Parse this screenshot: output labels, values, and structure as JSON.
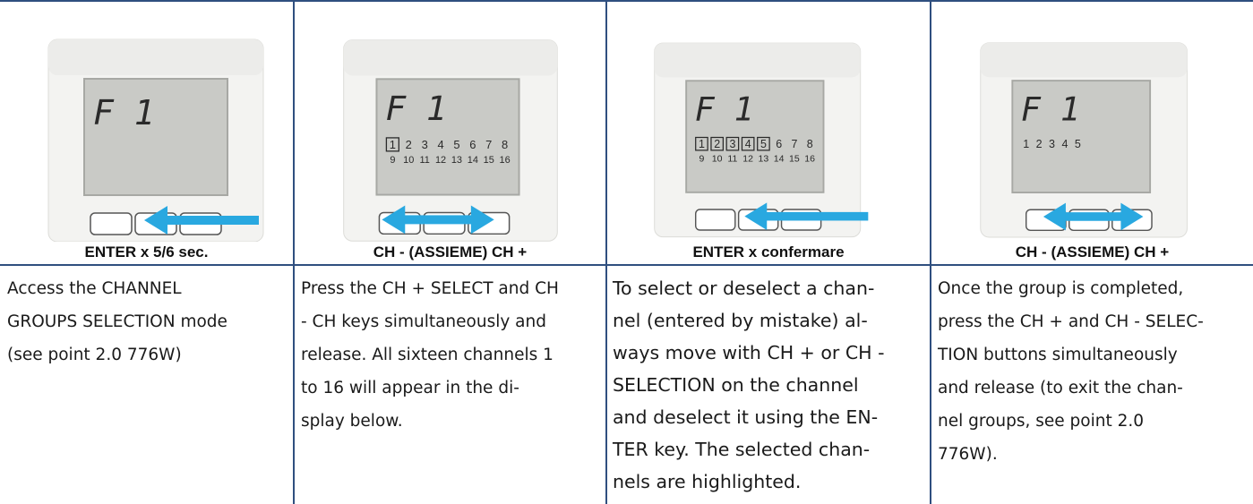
{
  "captions": [
    "ENTER x 5/6 sec.",
    "CH - (ASSIEME) CH +",
    "ENTER x confermare",
    "CH - (ASSIEME) CH +"
  ],
  "descriptions": [
    "Access the CHANNEL\nGROUPS SELECTION mode\n(see point 2.0 776W)",
    "Press the CH + SELECT and CH\n- CH keys simultaneously and\nrelease. All sixteen channels 1\nto 16 will appear in the di-\nsplay below.",
    "To select or deselect a chan-\nnel (entered by mistake) al-\nways move with CH + or CH -\nSELECTION on the channel\nand deselect it using the EN-\nTER key. The selected chan-\nnels are highlighted.",
    "Once the group is completed,\npress the CH + and CH - SELEC-\nTION buttons simultaneously\nand release (to exit the chan-\nnel groups, see point 2.0\n776W)."
  ],
  "displays": [
    {
      "function": "F 1",
      "row1": [],
      "row2": [],
      "boxed": []
    },
    {
      "function": "F 1",
      "row1": [
        "1",
        "2",
        "3",
        "4",
        "5",
        "6",
        "7",
        "8"
      ],
      "row2": [
        "9",
        "10",
        "11",
        "12",
        "13",
        "14",
        "15",
        "16"
      ],
      "boxed": [
        "1"
      ]
    },
    {
      "function": "F 1",
      "row1": [
        "1",
        "2",
        "3",
        "4",
        "5",
        "6",
        "7",
        "8"
      ],
      "row2": [
        "9",
        "10",
        "11",
        "12",
        "13",
        "14",
        "15",
        "16"
      ],
      "boxed": [
        "1",
        "2",
        "3",
        "4",
        "5"
      ]
    },
    {
      "function": "F 1",
      "row1": [
        "1",
        "2",
        "3",
        "4",
        "5"
      ],
      "row2": [],
      "boxed": []
    }
  ],
  "colors": {
    "frame": "#2f4f7f",
    "arrow": "#29a8e0",
    "lcd": "#c9cac6",
    "device": "#f4f4f2"
  },
  "icons": [
    "arrow-left-icon",
    "arrow-both-icon",
    "arrow-left-icon",
    "arrow-both-icon"
  ]
}
